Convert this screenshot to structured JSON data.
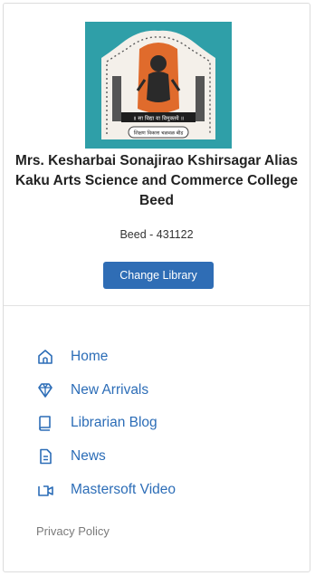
{
  "college": {
    "name_line1": "Mrs. Kesharbai Sonajirao Kshirsagar Alias",
    "name_line2": "Kaku Arts Science and Commerce College",
    "name_line3": "Beed",
    "location": "Beed - 431122",
    "change_button_label": "Change Library",
    "logo_inner_text": "॥ सा विद्या या विमुक्तये ॥",
    "logo_bottom_text": "शिक्षण विकास चळवळ बीड"
  },
  "nav": {
    "items": [
      {
        "label": "Home",
        "icon": "home-icon"
      },
      {
        "label": "New Arrivals",
        "icon": "diamond-icon"
      },
      {
        "label": "Librarian Blog",
        "icon": "book-icon"
      },
      {
        "label": "News",
        "icon": "document-icon"
      },
      {
        "label": "Mastersoft Video",
        "icon": "video-icon"
      }
    ]
  },
  "footer": {
    "privacy_label": "Privacy Policy"
  },
  "colors": {
    "accent": "#2f6db5",
    "link": "#2c6db7",
    "logo_teal": "#2f9fa8",
    "logo_orange": "#e06b2c"
  }
}
